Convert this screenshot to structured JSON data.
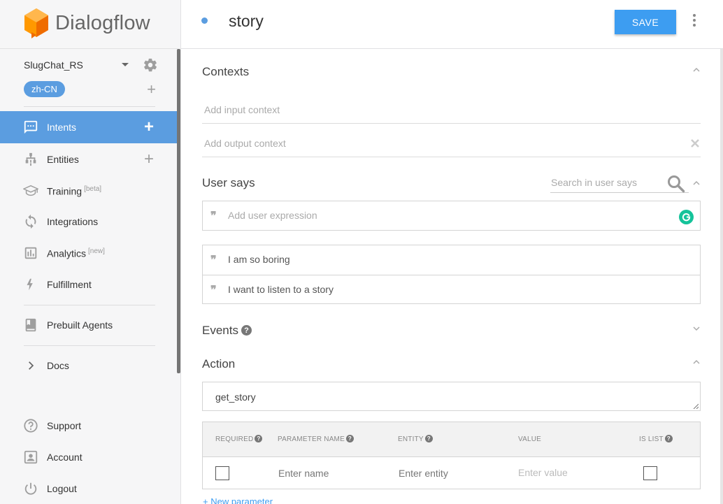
{
  "app": {
    "name": "Dialogflow",
    "accent": "#5b9de0",
    "logo_color": "#ff9800"
  },
  "agent": {
    "name": "SlugChat_RS",
    "language": "zh-CN"
  },
  "sidebar": {
    "items": [
      {
        "label": "Intents",
        "icon": "chat-icon",
        "active": true
      },
      {
        "label": "Entities",
        "icon": "hierarchy-icon"
      },
      {
        "label": "Training",
        "sup": "[beta]",
        "icon": "graduation-cap-icon"
      },
      {
        "label": "Integrations",
        "icon": "sync-icon"
      },
      {
        "label": "Analytics",
        "sup": "[new]",
        "icon": "bar-chart-icon"
      },
      {
        "label": "Fulfillment",
        "icon": "lightning-icon"
      },
      {
        "label": "Prebuilt Agents",
        "icon": "book-icon"
      },
      {
        "label": "Docs",
        "icon": "chevron-right-icon"
      },
      {
        "label": "Support",
        "icon": "help-circle-icon"
      },
      {
        "label": "Account",
        "icon": "account-box-icon"
      },
      {
        "label": "Logout",
        "icon": "power-icon"
      }
    ]
  },
  "intent": {
    "title": "story",
    "save_label": "SAVE"
  },
  "contexts": {
    "title": "Contexts",
    "input_placeholder": "Add input context",
    "output_placeholder": "Add output context"
  },
  "user_says": {
    "title": "User says",
    "search_placeholder": "Search in user says",
    "add_placeholder": "Add user expression",
    "expressions": [
      "I am so boring",
      "I want to listen to a story"
    ]
  },
  "events": {
    "title": "Events"
  },
  "action": {
    "title": "Action",
    "value": "get_story",
    "columns": [
      "REQUIRED",
      "PARAMETER NAME",
      "ENTITY",
      "VALUE",
      "IS LIST"
    ],
    "row_placeholders": {
      "name": "Enter name",
      "entity": "Enter entity",
      "value": "Enter value"
    },
    "new_parameter": "+ New parameter"
  }
}
